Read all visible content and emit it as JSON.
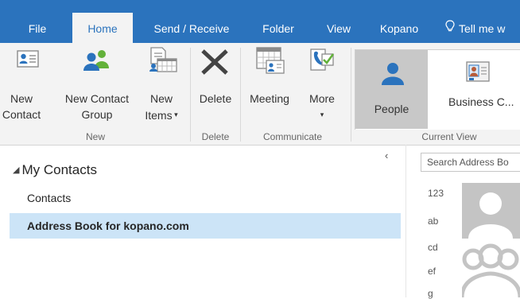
{
  "tabs": [
    {
      "label": "File"
    },
    {
      "label": "Home"
    },
    {
      "label": "Send / Receive"
    },
    {
      "label": "Folder"
    },
    {
      "label": "View"
    },
    {
      "label": "Kopano"
    },
    {
      "label": "Tell me w"
    }
  ],
  "ribbon": {
    "new_contact": {
      "line1": "New",
      "line2": "Contact"
    },
    "new_contact_group": {
      "line1": "New Contact",
      "line2": "Group"
    },
    "new_items": {
      "line1": "New",
      "line2": "Items"
    },
    "delete": {
      "label": "Delete"
    },
    "meeting": {
      "label": "Meeting"
    },
    "more": {
      "label": "More"
    },
    "people": {
      "label": "People"
    },
    "business_card": {
      "label": "Business C..."
    },
    "groups": {
      "new": "New",
      "delete": "Delete",
      "communicate": "Communicate",
      "current_view": "Current View"
    }
  },
  "nav": {
    "root": "My Contacts",
    "items": [
      {
        "label": "Contacts"
      },
      {
        "label": "Address Book for kopano.com"
      }
    ]
  },
  "search": {
    "placeholder": "Search Address Bo"
  },
  "az_index": [
    "123",
    "ab",
    "cd",
    "ef",
    "g"
  ],
  "colors": {
    "accent": "#2b73bd",
    "ribbon_bg": "#f3f3f3",
    "selection": "#cce4f7"
  }
}
